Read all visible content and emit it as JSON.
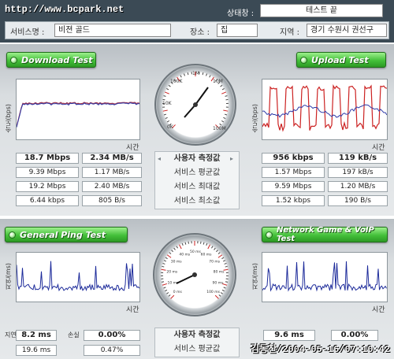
{
  "watermark_top": "http://www.bcpark.net",
  "watermark_bottom": "김동찬/2004-05-16/07:10:42",
  "header": {
    "status_label": "상태창 :",
    "status_value": "테스트 끝",
    "service_label": "서비스명 :",
    "service_value": "비젼 골드",
    "place_label": "장소 :",
    "place_value": "집",
    "region_label": "지역 :",
    "region_value": "경기 수원시 권선구 "
  },
  "download": {
    "title": "Download Test",
    "axis_label": "속도(bps)",
    "time_label": "시간",
    "line_color": "#9b2f4a",
    "line2_color": "#2e3aa8"
  },
  "upload": {
    "title": "Upload Test",
    "axis_label": "속도(bps)",
    "time_label": "시간",
    "line_color": "#cc2222",
    "line2_color": "#2e3aa8"
  },
  "speed_gauge": {
    "ticks": [
      "10K",
      "100K",
      "1M",
      "10M",
      "100M",
      "0K"
    ],
    "needle_value": "~2M"
  },
  "speed_rows": {
    "labels": [
      "사용자 측정값",
      "서비스 평균값",
      "서비스 최대값",
      "서비스 최소값"
    ],
    "download": [
      [
        "18.7 Mbps",
        "2.34 MB/s"
      ],
      [
        "9.39 Mbps",
        "1.17 MB/s"
      ],
      [
        "19.2 Mbps",
        "2.40 MB/s"
      ],
      [
        "6.44 kbps",
        "805 B/s"
      ]
    ],
    "upload": [
      [
        "956 kbps",
        "119 kB/s"
      ],
      [
        "1.57 Mbps",
        "197 kB/s"
      ],
      [
        "9.59 Mbps",
        "1.20 MB/s"
      ],
      [
        "1.52 kbps",
        "190 B/s"
      ]
    ]
  },
  "ping": {
    "title": "General Ping Test",
    "axis_label": "지연(ms)",
    "time_label": "시간",
    "line_color": "#1c2a9a"
  },
  "game": {
    "title": "Network Game & VoIP Test",
    "axis_label": "지연(ms)",
    "time_label": "시간",
    "line_color": "#1c2a9a"
  },
  "ping_gauge": {
    "ticks": [
      "0 ms",
      "10 ms",
      "20 ms",
      "30 ms",
      "40 ms",
      "50 ms",
      "60 ms",
      "70 ms",
      "80 ms",
      "90 ms",
      "100 ms"
    ]
  },
  "ping_rows": {
    "labels": [
      "사용자 측정값",
      "서비스 평균값"
    ],
    "side_label_left": "지연",
    "side_label_mid": "손실",
    "ping": [
      [
        "8.2 ms",
        "0.00%"
      ],
      [
        "19.6 ms",
        "0.47%"
      ]
    ],
    "game": [
      [
        "9.6 ms",
        "0.00%"
      ]
    ]
  }
}
